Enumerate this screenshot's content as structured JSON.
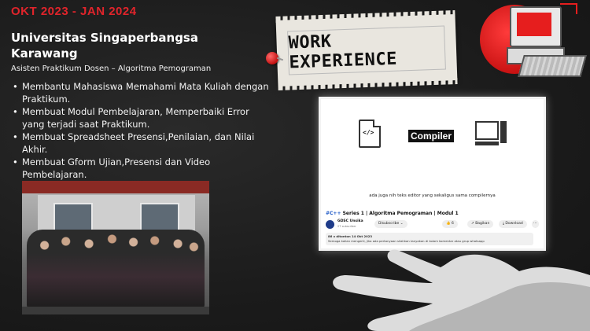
{
  "period": "OKT 2023 - JAN 2024",
  "university": "Universitas Singaperbangsa Karawang",
  "role": "Asisten Praktikum Dosen – Algoritma Pemograman",
  "bullets": [
    "Membantu Mahasiswa Memahami Mata Kuliah dengan Praktikum.",
    "Membuat Modul Pembelajaran, Memperbaiki Error yang terjadi saat Praktikum.",
    "Membuat Spreadsheet Presensi,Penilaian, dan Nilai Akhir.",
    "Membuat Gform Ujian,Presensi dan Video Pembelajaran."
  ],
  "section_title": "WORK EXPERIENCE",
  "video": {
    "file_icon_text": "</>",
    "compiler_label": "Compiler",
    "caption": "ada juga nih teks editor yang sekaligus sama compilernya",
    "title_tag": "#C++",
    "title": " Series 1 | Algoritma Pemograman | Modul 1",
    "channel_name": "GDSC Unsika",
    "channel_subs": "27 subscriber",
    "subscribe_label": "Disubscribe ⌄",
    "like_count": "6",
    "share_label": "Bagikan",
    "download_label": "Download",
    "more_label": "⋯",
    "views_line": "86 x ditonton  14 Okt 2023",
    "description": "Semoga kalian mengerti, jika ada pertanyaan silahkan tanyakan di kolom komentar atau grup whatsapp"
  },
  "colors": {
    "accent": "#e0242b",
    "background": "#1e1e1e"
  }
}
